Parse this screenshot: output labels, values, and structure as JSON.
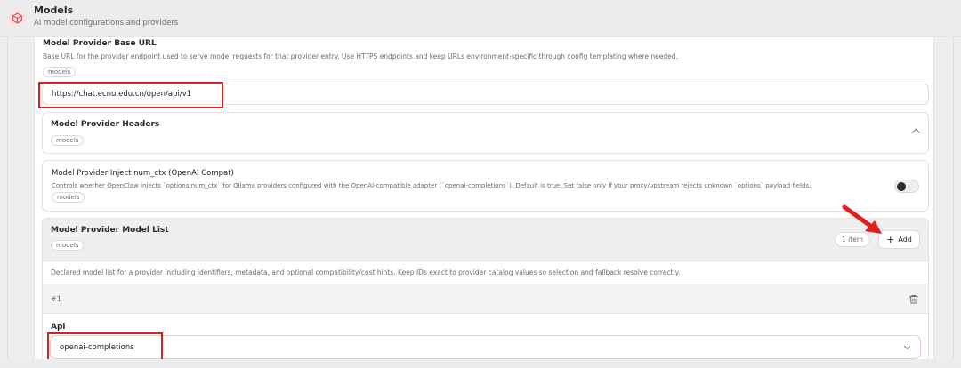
{
  "header": {
    "title": "Models",
    "subtitle": "AI model configurations and providers",
    "icon": "cube-icon"
  },
  "base_url": {
    "label": "Model Provider Base URL",
    "description": "Base URL for the provider endpoint used to serve model requests for that provider entry. Use HTTPS endpoints and keep URLs environment-specific through config templating where needed.",
    "tag": "models",
    "value": "https://chat.ecnu.edu.cn/open/api/v1"
  },
  "headers": {
    "label": "Model Provider Headers",
    "tag": "models"
  },
  "num_ctx": {
    "label": "Model Provider Inject num_ctx (OpenAI Compat)",
    "description": "Controls whether OpenClaw injects `options.num_ctx` for Ollama providers configured with the OpenAI-compatible adapter (`openai-completions`). Default is true. Set false only if your proxy/upstream rejects unknown `options` payload fields.",
    "tag": "models",
    "enabled": false
  },
  "model_list": {
    "label": "Model Provider Model List",
    "tag": "models",
    "count_label": "1 item",
    "add_label": "Add",
    "description": "Declared model list for a provider including identifiers, metadata, and optional compatibility/cost hints. Keep IDs exact to provider catalog values so selection and fallback resolve correctly.",
    "item_number": "#1",
    "api_label": "Api",
    "api_value": "openai-completions"
  },
  "colors": {
    "highlight": "#e01e1e",
    "accent_icon": "#e0454b"
  }
}
